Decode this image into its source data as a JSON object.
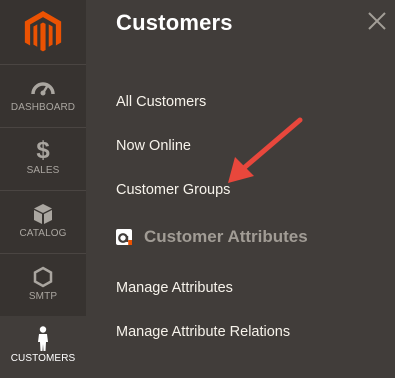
{
  "sidebar": {
    "items": [
      {
        "label": "DASHBOARD",
        "icon": "dashboard-icon"
      },
      {
        "label": "SALES",
        "icon": "dollar-icon"
      },
      {
        "label": "CATALOG",
        "icon": "cube-icon"
      },
      {
        "label": "SMTP",
        "icon": "hexagon-icon"
      },
      {
        "label": "CUSTOMERS",
        "icon": "person-icon"
      }
    ],
    "active_index": 4
  },
  "panel": {
    "title": "Customers",
    "links": [
      "All Customers",
      "Now Online",
      "Customer Groups"
    ],
    "section_label": "Customer Attributes",
    "section_links": [
      "Manage Attributes",
      "Manage Attribute Relations"
    ]
  },
  "colors": {
    "sidebar_bg": "#373330",
    "panel_bg": "#413d3a",
    "logo_orange": "#eb5202",
    "arrow_red": "#e8473c"
  }
}
